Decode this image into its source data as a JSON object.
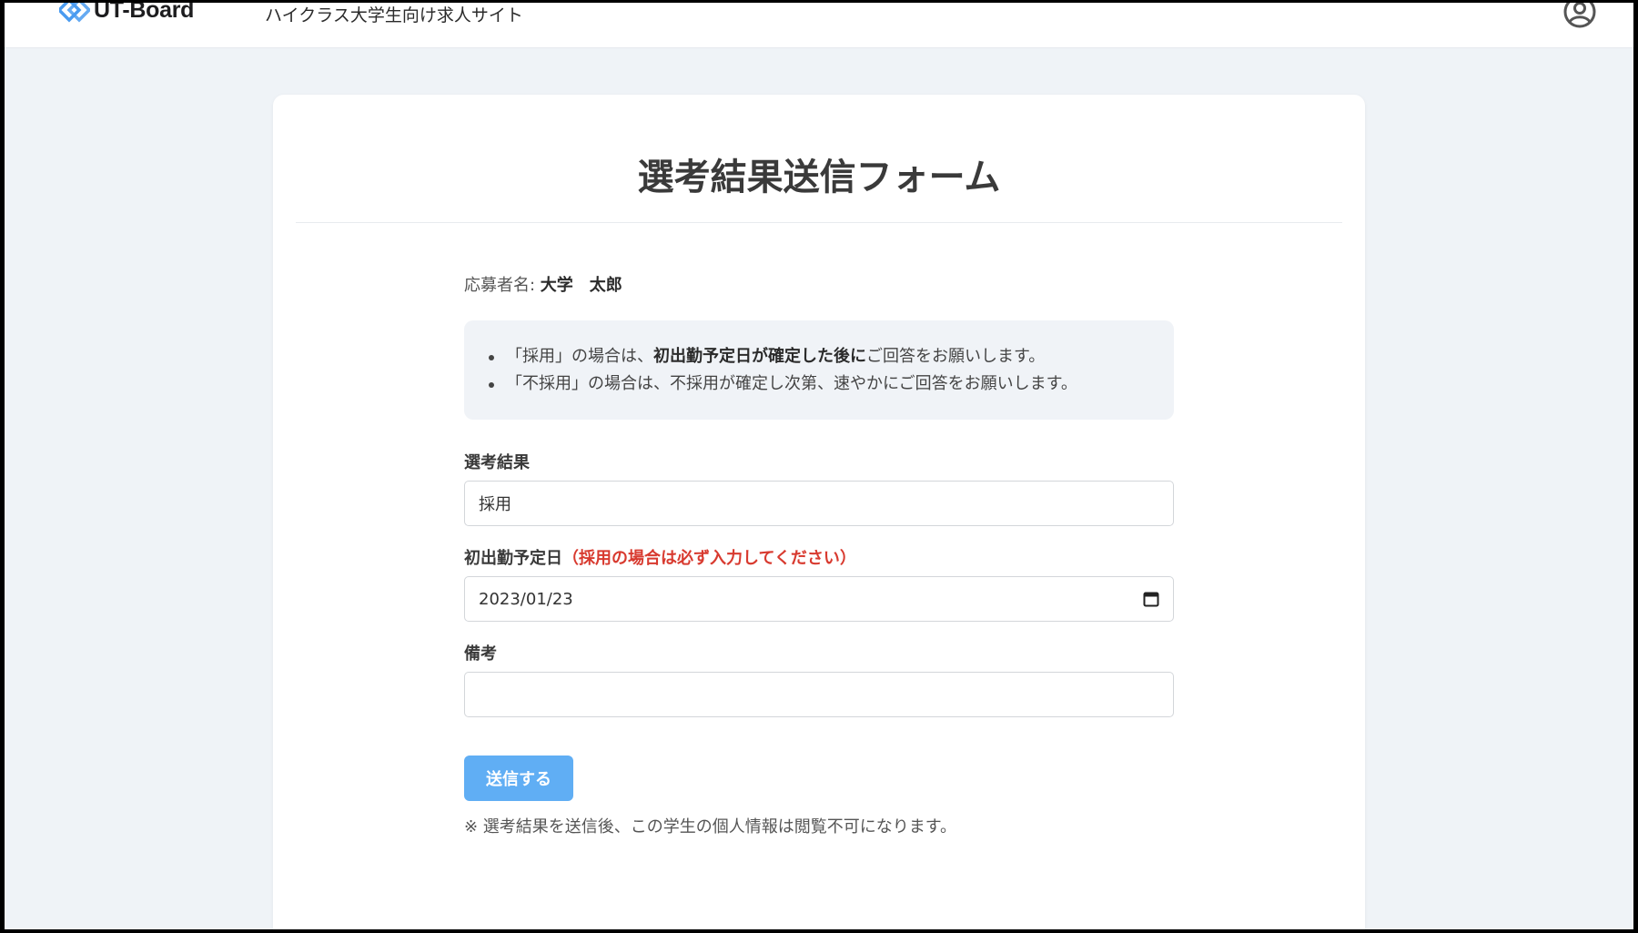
{
  "header": {
    "logo_text": "UT-Board",
    "tagline": "ハイクラス大学生向け求人サイト",
    "brand_color": "#4a9bf0"
  },
  "form": {
    "title": "選考結果送信フォーム",
    "applicant_label": "応募者名: ",
    "applicant_name": "大学　太郎",
    "notice": {
      "item1_prefix": "「採用」の場合は、",
      "item1_bold": "初出勤予定日が確定した後に",
      "item1_suffix": "ご回答をお願いします。",
      "item2": "「不採用」の場合は、不採用が確定し次第、速やかにご回答をお願いします。"
    },
    "result_label": "選考結果",
    "result_value": "採用",
    "start_date_label": "初出勤予定日",
    "start_date_required": "（採用の場合は必ず入力してください）",
    "start_date_value": "2023/01/23",
    "remarks_label": "備考",
    "remarks_value": "",
    "submit_label": "送信する",
    "footnote": "※ 選考結果を送信後、この学生の個人情報は閲覧不可になります。"
  },
  "colors": {
    "page_bg": "#eff3f7",
    "card_bg": "#ffffff",
    "button": "#60aef4",
    "required_text": "#d83a2f"
  }
}
